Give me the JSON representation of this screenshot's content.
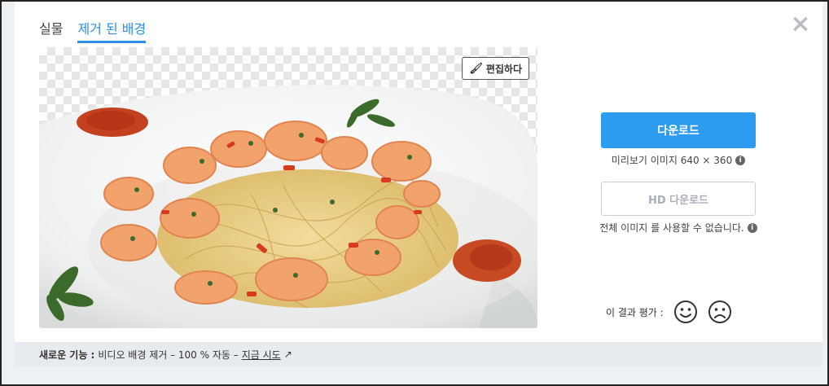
{
  "tabs": [
    {
      "label": "실물",
      "active": false
    },
    {
      "label": "제거 된 배경",
      "active": true
    }
  ],
  "close_icon": "close-icon",
  "preview": {
    "edit_label": "편집하다",
    "edit_icon": "brush-icon"
  },
  "download": {
    "button_label": "다운로드",
    "preview_note": "미리보기 이미지 640 × 360",
    "hd_button_label": "HD 다운로드",
    "hd_note": "전체 이미지 를 사용할 수 없습니다."
  },
  "rating": {
    "label": "이 결과 평가 :"
  },
  "footer": {
    "new_feature_label": "새로운 기능 :",
    "feature_text": "비디오 배경 제거 – 100 % 자동 –",
    "link_label": "지금 시도"
  },
  "colors": {
    "accent": "#2d9bf0",
    "tab_active": "#2d8ee6"
  }
}
